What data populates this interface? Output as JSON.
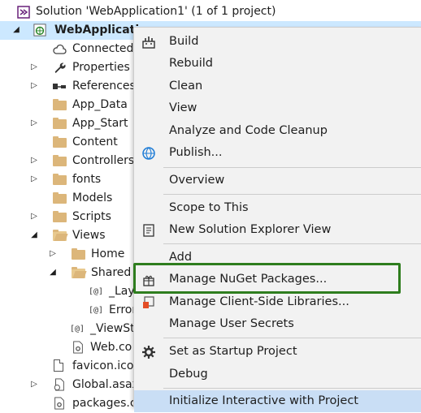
{
  "tree": {
    "solution_label": "Solution 'WebApplication1' (1 of 1 project)",
    "project_label": "WebApplicatio",
    "items": {
      "connected": "Connected",
      "properties": "Properties",
      "references": "References",
      "app_data": "App_Data",
      "app_start": "App_Start",
      "content": "Content",
      "controllers": "Controllers",
      "fonts": "fonts",
      "models": "Models",
      "scripts": "Scripts",
      "views": "Views",
      "home": "Home",
      "shared": "Shared",
      "layout": "_Lay",
      "error": "Error",
      "viewstart": "_ViewSt",
      "webconfig": "Web.co",
      "favicon": "favicon.ico",
      "global": "Global.asax",
      "packages": "packages.c"
    },
    "razor_badge": "[@]"
  },
  "menu": {
    "items": [
      {
        "label": "Build",
        "icon": "build-icon"
      },
      {
        "label": "Rebuild"
      },
      {
        "label": "Clean"
      },
      {
        "label": "View"
      },
      {
        "label": "Analyze and Code Cleanup"
      },
      {
        "label": "Publish...",
        "icon": "globe-icon"
      },
      {
        "label": "Overview"
      },
      {
        "label": "Scope to This"
      },
      {
        "label": "New Solution Explorer View",
        "icon": "new-view-icon"
      },
      {
        "label": "Add"
      },
      {
        "label": "Manage NuGet Packages...",
        "icon": "nuget-icon"
      },
      {
        "label": "Manage Client-Side Libraries...",
        "icon": "libraries-icon"
      },
      {
        "label": "Manage User Secrets"
      },
      {
        "label": "Set as Startup Project",
        "icon": "gear-icon"
      },
      {
        "label": "Debug"
      },
      {
        "label": "Initialize Interactive with Project"
      }
    ]
  },
  "colors": {
    "selection": "#cce8ff",
    "highlight_border": "#2e7d1e",
    "menu_background": "#f2f2f2",
    "folder": "#dcb67a"
  }
}
